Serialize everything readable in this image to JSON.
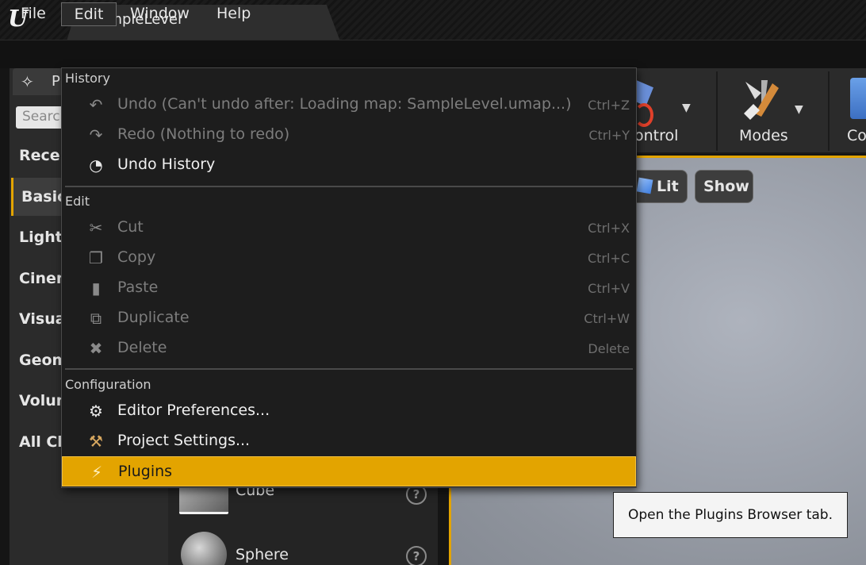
{
  "window": {
    "tab_title": "SampleLevel",
    "logo": "U"
  },
  "menubar": {
    "items": [
      "File",
      "Edit",
      "Window",
      "Help"
    ],
    "open_menu": "Edit"
  },
  "left_panel": {
    "tab_label": "P",
    "tab_icon": "place-actors-icon",
    "search_placeholder": "Searc",
    "categories": [
      "Recen",
      "Basic",
      "Lights",
      "Cinen",
      "Visua",
      "Geom",
      "Volun",
      "All Cla"
    ],
    "active_category": "Basic"
  },
  "asset_list": {
    "items": [
      {
        "label": "Cube",
        "icon": "cube-icon"
      },
      {
        "label": "Sphere",
        "icon": "sphere-icon"
      }
    ]
  },
  "toolbar": {
    "items": [
      {
        "label": "ontrol"
      },
      {
        "label": "Modes"
      },
      {
        "label": "Co"
      }
    ]
  },
  "viewport": {
    "buttons": [
      "Lit",
      "Show"
    ]
  },
  "edit_menu": {
    "sections": [
      {
        "title": "History",
        "items": [
          {
            "label": "Undo (Can't undo after: Loading map: SampleLevel.umap...)",
            "shortcut": "Ctrl+Z",
            "enabled": false,
            "icon": "undo-icon"
          },
          {
            "label": "Redo (Nothing to redo)",
            "shortcut": "Ctrl+Y",
            "enabled": false,
            "icon": "redo-icon"
          },
          {
            "label": "Undo History",
            "shortcut": "",
            "enabled": true,
            "icon": "undo-history-icon"
          }
        ]
      },
      {
        "title": "Edit",
        "items": [
          {
            "label": "Cut",
            "shortcut": "Ctrl+X",
            "enabled": false,
            "icon": "scissors-icon"
          },
          {
            "label": "Copy",
            "shortcut": "Ctrl+C",
            "enabled": false,
            "icon": "copy-icon"
          },
          {
            "label": "Paste",
            "shortcut": "Ctrl+V",
            "enabled": false,
            "icon": "paste-icon"
          },
          {
            "label": "Duplicate",
            "shortcut": "Ctrl+W",
            "enabled": false,
            "icon": "duplicate-icon"
          },
          {
            "label": "Delete",
            "shortcut": "Delete",
            "enabled": false,
            "icon": "delete-icon"
          }
        ]
      },
      {
        "title": "Configuration",
        "items": [
          {
            "label": "Editor Preferences...",
            "shortcut": "",
            "enabled": true,
            "icon": "editor-preferences-icon"
          },
          {
            "label": "Project Settings...",
            "shortcut": "",
            "enabled": true,
            "icon": "project-settings-icon"
          },
          {
            "label": "Plugins",
            "shortcut": "",
            "enabled": true,
            "highlighted": true,
            "icon": "plugins-icon"
          }
        ]
      }
    ]
  },
  "tooltip": {
    "text": "Open the Plugins Browser tab."
  },
  "colors": {
    "accent": "#e3a400",
    "menu_bg": "#1d1d1d",
    "disabled_text": "#7d7d7d"
  }
}
